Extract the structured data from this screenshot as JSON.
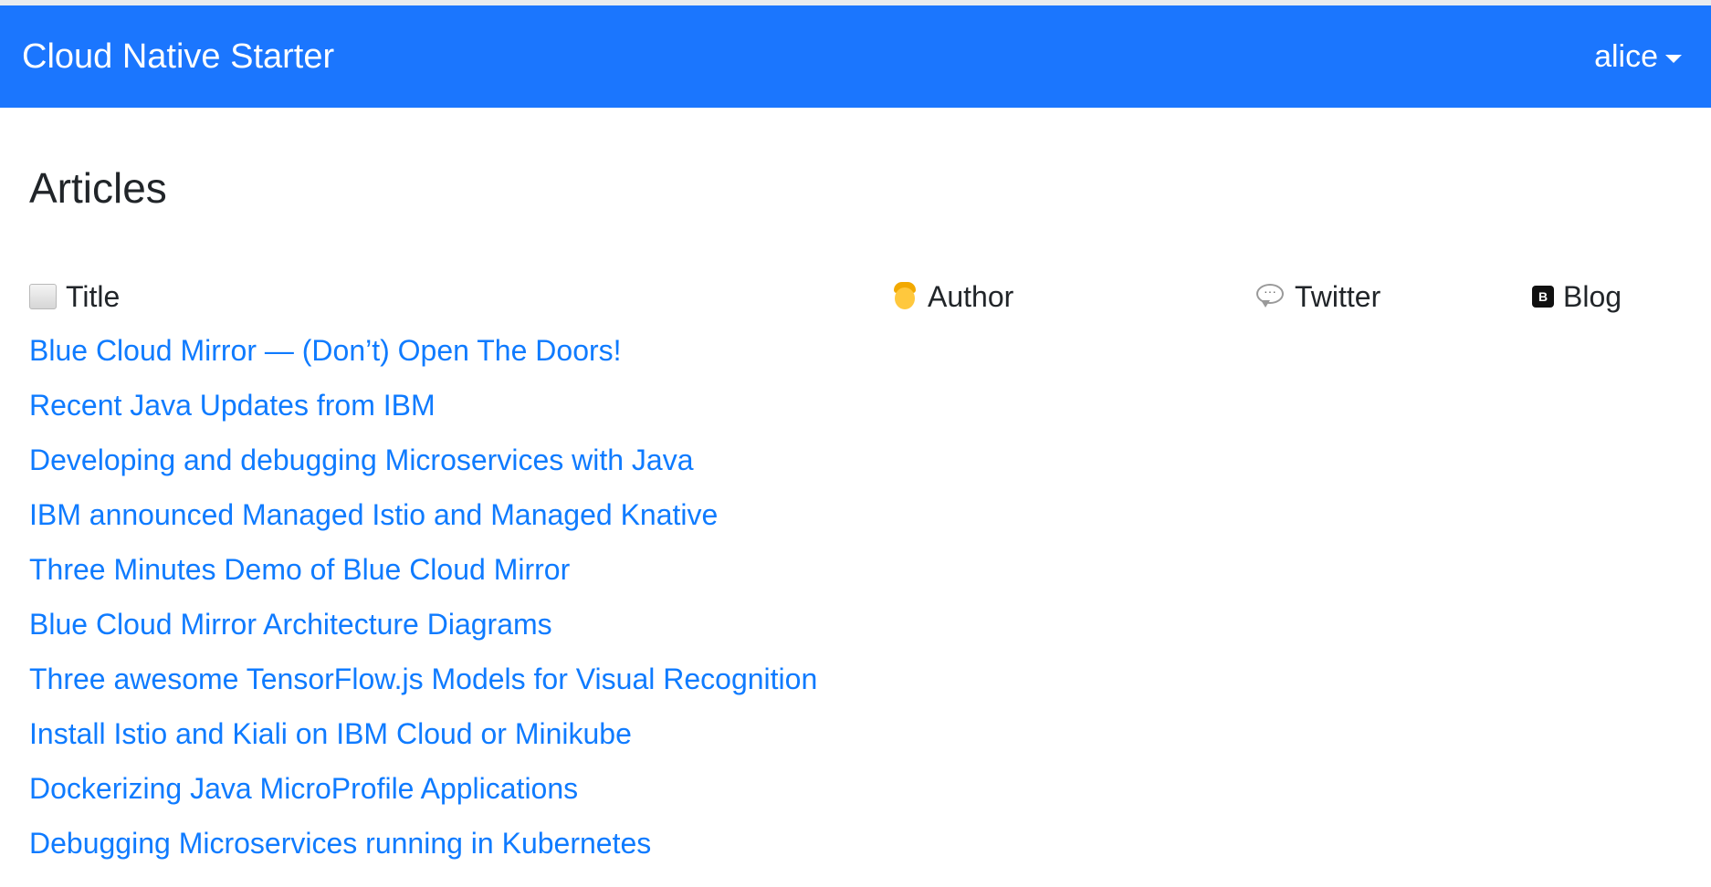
{
  "navbar": {
    "brand": "Cloud Native Starter",
    "user": "alice"
  },
  "page": {
    "title": "Articles"
  },
  "table": {
    "headers": {
      "title": "Title",
      "author": "Author",
      "twitter": "Twitter",
      "blog": "Blog"
    },
    "header_icons": {
      "title": "scroll-icon",
      "author": "person-icon",
      "twitter": "speech-bubble-icon",
      "blog": "b-icon"
    },
    "rows": [
      {
        "title": "Blue Cloud Mirror — (Don’t) Open The Doors!"
      },
      {
        "title": "Recent Java Updates from IBM"
      },
      {
        "title": "Developing and debugging Microservices with Java"
      },
      {
        "title": "IBM announced Managed Istio and Managed Knative"
      },
      {
        "title": "Three Minutes Demo of Blue Cloud Mirror"
      },
      {
        "title": "Blue Cloud Mirror Architecture Diagrams"
      },
      {
        "title": "Three awesome TensorFlow.js Models for Visual Recognition"
      },
      {
        "title": "Install Istio and Kiali on IBM Cloud or Minikube"
      },
      {
        "title": "Dockerizing Java MicroProfile Applications"
      },
      {
        "title": "Debugging Microservices running in Kubernetes"
      }
    ]
  },
  "colors": {
    "navbar": "#1b76fe",
    "link": "#0f7bff",
    "text": "#212529"
  }
}
